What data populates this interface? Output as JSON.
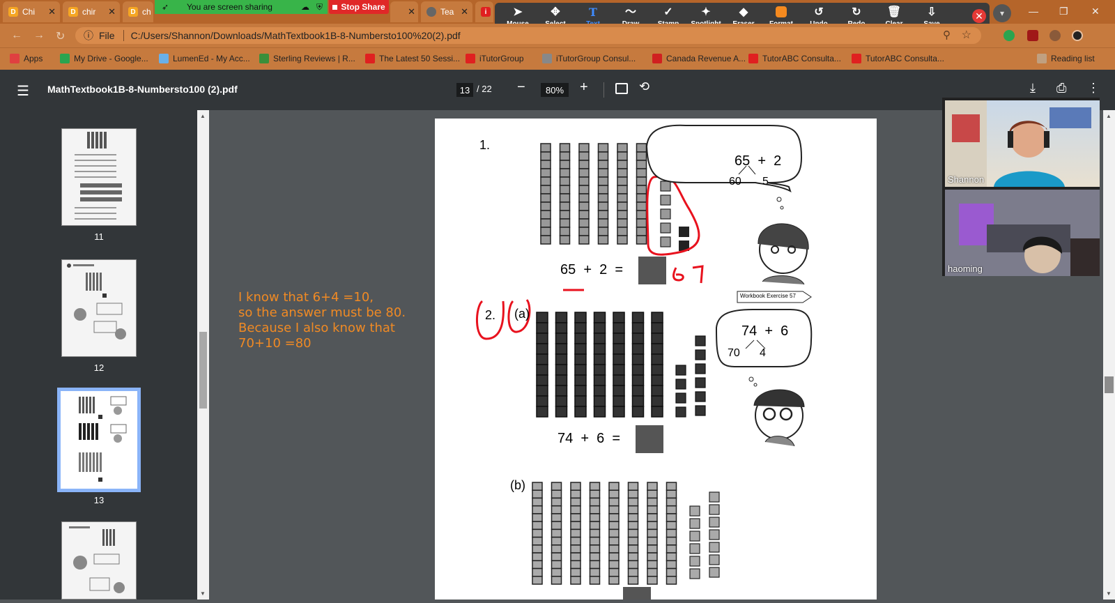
{
  "tabs": [
    {
      "label": "Chi",
      "fav": "D"
    },
    {
      "label": "chir",
      "fav": "D"
    },
    {
      "label": "ch",
      "fav": "D"
    },
    {
      "label": "",
      "fav": ""
    },
    {
      "label": "Tea",
      "fav": ""
    },
    {
      "label": "",
      "fav": "i"
    }
  ],
  "share": {
    "status": "You are screen sharing",
    "stop_label": "Stop Share"
  },
  "annotate": {
    "tools": [
      {
        "label": "Mouse",
        "icon": "mouse-pointer-icon"
      },
      {
        "label": "Select",
        "icon": "move-icon"
      },
      {
        "label": "Text",
        "icon": "text-icon"
      },
      {
        "label": "Draw",
        "icon": "draw-icon"
      },
      {
        "label": "Stamp",
        "icon": "stamp-icon"
      },
      {
        "label": "Spotlight",
        "icon": "spotlight-icon"
      },
      {
        "label": "Eraser",
        "icon": "eraser-icon"
      },
      {
        "label": "Format",
        "icon": "format-icon"
      },
      {
        "label": "Undo",
        "icon": "undo-icon"
      },
      {
        "label": "Redo",
        "icon": "redo-icon"
      },
      {
        "label": "Clear",
        "icon": "trash-icon"
      },
      {
        "label": "Save",
        "icon": "save-icon"
      }
    ],
    "active": "Text",
    "format_color": "#f58a1f"
  },
  "address": {
    "scheme_label": "File",
    "url": "C:/Users/Shannon/Downloads/MathTextbook1B-8-Numbersto100%20(2).pdf"
  },
  "bookmarks": [
    {
      "label": "Apps",
      "color": "#e04040"
    },
    {
      "label": "My Drive - Google...",
      "color": "#2aa44f"
    },
    {
      "label": "LumenEd - My Acc...",
      "color": "#6ab0e8"
    },
    {
      "label": "Sterling Reviews | R...",
      "color": "#3a8f3a"
    },
    {
      "label": "The Latest 50 Sessi...",
      "color": "#e02020"
    },
    {
      "label": "iTutorGroup",
      "color": "#e02020"
    },
    {
      "label": "iTutorGroup Consul...",
      "color": "#888888"
    },
    {
      "label": "Canada Revenue A...",
      "color": "#d02020"
    },
    {
      "label": "TutorABC Consulta...",
      "color": "#e02020"
    },
    {
      "label": "TutorABC Consulta...",
      "color": "#e02020"
    },
    {
      "label": "Reading list",
      "color": "#c0a080"
    }
  ],
  "pdf": {
    "title": "MathTextbook1B-8-Numbersto100 (2).pdf",
    "page": "13",
    "total": "/ 22",
    "zoom": "80%"
  },
  "thumbnails": [
    {
      "label": "11"
    },
    {
      "label": "12"
    },
    {
      "label": "13"
    },
    {
      "label": ""
    }
  ],
  "overlay_text": "I know that 6+4 =10,\nso the answer must be 80.\nBecause I also know that\n70+10 =80",
  "page_content": {
    "q1_number": "1.",
    "q1_bubble_top": "65  +  2",
    "q1_bubble_left": "60",
    "q1_bubble_right": "5",
    "q1_equation": "65  +  2  =",
    "q1_answer_handwritten": "67",
    "workbook_label": "Workbook Exercise 57",
    "q2_number": "2.",
    "q2a_label": "(a)",
    "q2_bubble_top": "74  +  6",
    "q2_bubble_left": "70",
    "q2_bubble_right": "4",
    "q2_equation": "74  +  6  =",
    "q2b_label": "(b)"
  },
  "participants": [
    {
      "name": "Shannon"
    },
    {
      "name": "haoming"
    }
  ]
}
